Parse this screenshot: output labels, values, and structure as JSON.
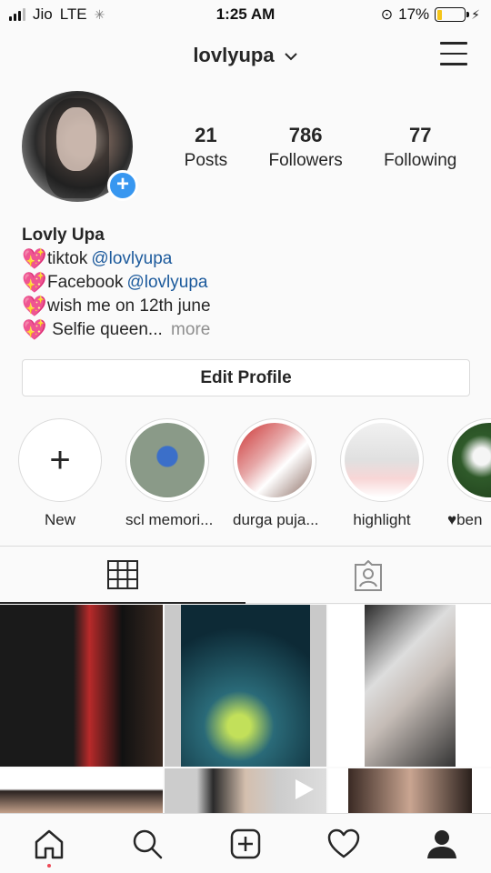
{
  "status_bar": {
    "carrier": "Jio",
    "network": "LTE",
    "time": "1:25 AM",
    "battery_percent": "17%",
    "battery_level": 0.17
  },
  "header": {
    "username": "lovlyupa"
  },
  "profile": {
    "stats": [
      {
        "num": "21",
        "label": "Posts"
      },
      {
        "num": "786",
        "label": "Followers"
      },
      {
        "num": "77",
        "label": "Following"
      }
    ],
    "display_name": "Lovly Upa",
    "bio": [
      {
        "text": "tiktok ",
        "link": "@lovlyupa"
      },
      {
        "text": "Facebook ",
        "link": "@lovlyupa"
      },
      {
        "text": "wish me on 12th june",
        "link": ""
      },
      {
        "text": " Selfie queen... ",
        "more": "more"
      }
    ],
    "edit_button": "Edit Profile"
  },
  "highlights": [
    {
      "label": "New"
    },
    {
      "label": "scl memori..."
    },
    {
      "label": "durga puja..."
    },
    {
      "label": "highlight"
    },
    {
      "label": "♥ben"
    }
  ],
  "colors": {
    "accent": "#3897f0",
    "link": "#1c5a9c",
    "notification": "#ed4956",
    "battery": "#f5c518"
  },
  "icons": {
    "tab_grid": "grid-icon",
    "tab_tagged": "tagged-icon",
    "nav": [
      "home-icon",
      "search-icon",
      "add-post-icon",
      "activity-heart-icon",
      "profile-icon"
    ]
  }
}
